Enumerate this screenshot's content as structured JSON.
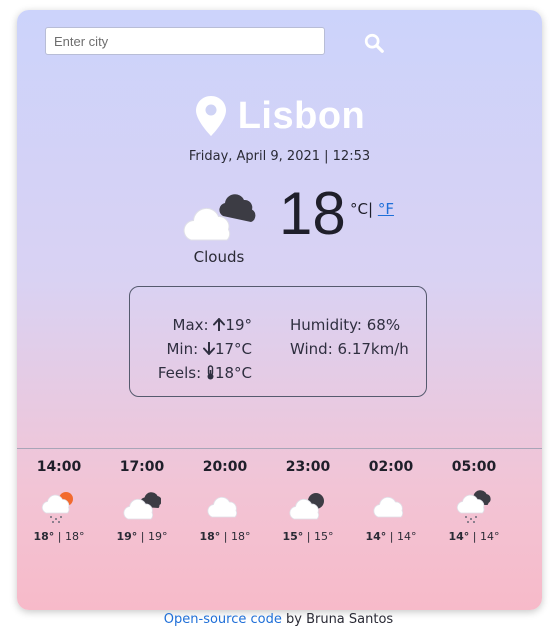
{
  "search": {
    "placeholder": "Enter city",
    "value": ""
  },
  "city": {
    "name": "Lisbon"
  },
  "datetime": "Friday, April 9, 2021 | 12:53",
  "current": {
    "icon": "clouds-icon",
    "condition": "Clouds",
    "temperature": "18",
    "unit_celsius": "°C",
    "unit_separator": "|",
    "unit_fahrenheit": "°F"
  },
  "details": {
    "max_label": "Max:",
    "max_value": "19°",
    "min_label": "Min:",
    "min_value": "17°C",
    "feels_label": "Feels:",
    "feels_value": "18°C",
    "humidity": "Humidity: 68%",
    "wind": "Wind: 6.17km/h"
  },
  "forecast": [
    {
      "time": "14:00",
      "icon": "sun-rain-cloud-icon",
      "max": "18°",
      "min": "18°"
    },
    {
      "time": "17:00",
      "icon": "broken-clouds-icon",
      "max": "19°",
      "min": "19°"
    },
    {
      "time": "20:00",
      "icon": "cloud-icon",
      "max": "18°",
      "min": "18°"
    },
    {
      "time": "23:00",
      "icon": "moon-cloud-icon",
      "max": "15°",
      "min": "15°"
    },
    {
      "time": "02:00",
      "icon": "cloud-icon",
      "max": "14°",
      "min": "14°"
    },
    {
      "time": "05:00",
      "icon": "dark-cloud-rain-icon",
      "max": "14°",
      "min": "14°"
    }
  ],
  "footer": {
    "link_text": "Open-source code",
    "suffix": " by Bruna Santos"
  },
  "colors": {
    "accent": "#1f6fd8",
    "card_top": "#ccd3fb",
    "card_bottom": "#f7bac9"
  }
}
